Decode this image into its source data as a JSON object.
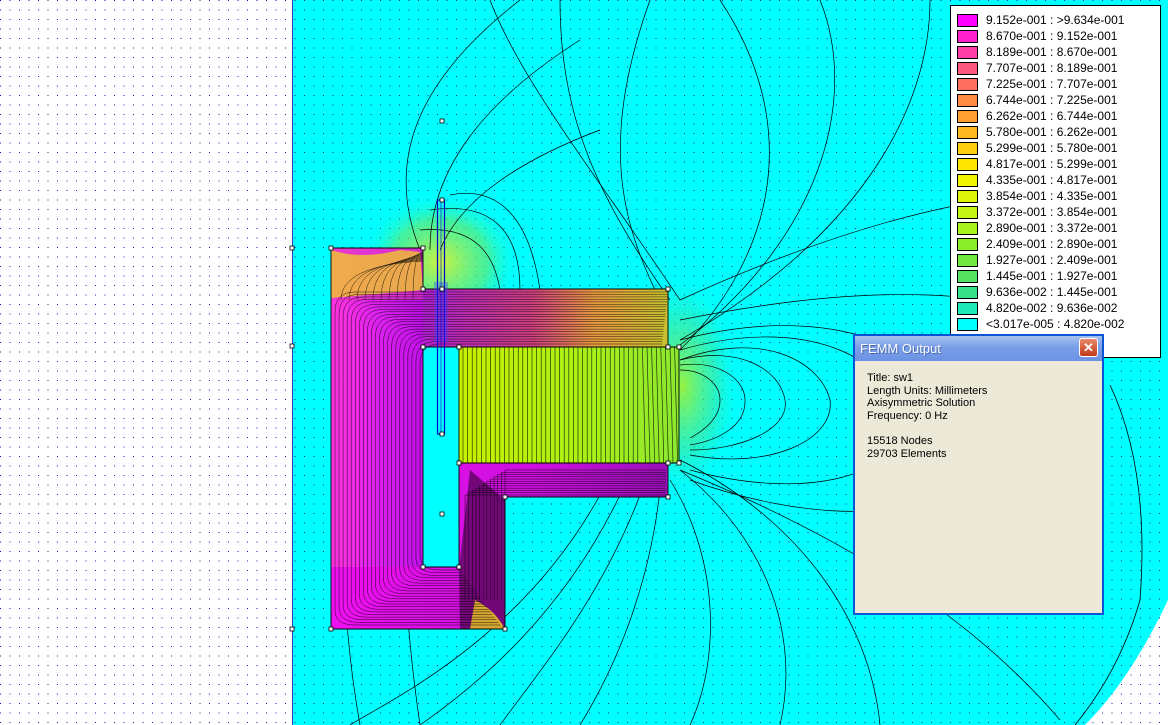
{
  "legend": {
    "entries": [
      {
        "label": "9.152e-001 : >9.634e-001",
        "color": "#ff00ff"
      },
      {
        "label": "8.670e-001 : 9.152e-001",
        "color": "#ff22cc"
      },
      {
        "label": "8.189e-001 : 8.670e-001",
        "color": "#ff3fa8"
      },
      {
        "label": "7.707e-001 : 8.189e-001",
        "color": "#ff5880"
      },
      {
        "label": "7.225e-001 : 7.707e-001",
        "color": "#ff6e60"
      },
      {
        "label": "6.744e-001 : 7.225e-001",
        "color": "#ff8a44"
      },
      {
        "label": "6.262e-001 : 6.744e-001",
        "color": "#ffa030"
      },
      {
        "label": "5.780e-001 : 6.262e-001",
        "color": "#ffb820"
      },
      {
        "label": "5.299e-001 : 5.780e-001",
        "color": "#ffcf10"
      },
      {
        "label": "4.817e-001 : 5.299e-001",
        "color": "#ffe600"
      },
      {
        "label": "4.335e-001 : 4.817e-001",
        "color": "#f2f500"
      },
      {
        "label": "3.854e-001 : 4.335e-001",
        "color": "#ddf50a"
      },
      {
        "label": "3.372e-001 : 3.854e-001",
        "color": "#c4f514"
      },
      {
        "label": "2.890e-001 : 3.372e-001",
        "color": "#a8f21e"
      },
      {
        "label": "2.409e-001 : 2.890e-001",
        "color": "#8cee28"
      },
      {
        "label": "1.927e-001 : 2.409e-001",
        "color": "#70e840"
      },
      {
        "label": "1.445e-001 : 1.927e-001",
        "color": "#55e260"
      },
      {
        "label": "9.636e-002 : 1.445e-001",
        "color": "#38e088"
      },
      {
        "label": "4.820e-002 : 9.636e-002",
        "color": "#1ce8b8"
      },
      {
        "label": "<3.017e-005 : 4.820e-002",
        "color": "#00ffff"
      }
    ]
  },
  "output_window": {
    "title": "FEMM Output",
    "lines": [
      "Title: sw1",
      "Length Units: Millimeters",
      "Axisymmetric Solution",
      "Frequency: 0 Hz",
      "",
      "15518 Nodes",
      "29703 Elements"
    ]
  },
  "colors": {
    "background_field": "#00ffff",
    "core_high": "#ff00ff",
    "mid_field": "#a8f21e",
    "grid_dot": "#0000aa"
  }
}
